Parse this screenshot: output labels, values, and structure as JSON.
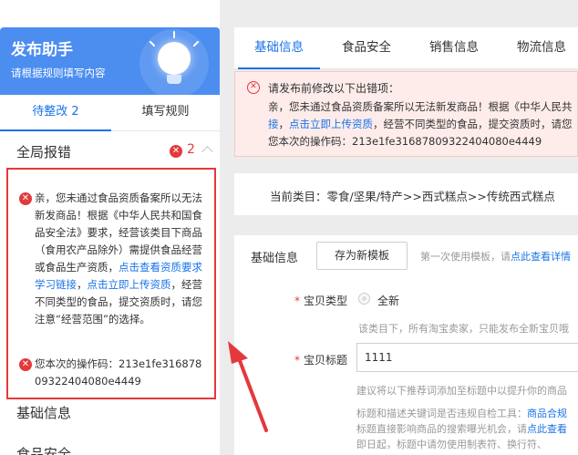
{
  "helper": {
    "title": "发布助手",
    "subtitle": "请根据规则填写内容"
  },
  "left_tabs": {
    "pending": "待整改 2",
    "rules": "填写规则"
  },
  "global_error": {
    "label": "全局报错",
    "count": "2"
  },
  "errors": {
    "e1_a": "亲，您未通过食品资质备案所以无法新发商品！根据《中华人民共和国食品安全法》要求，经营该类目下商品（食用农产品除外）需提供食品经营或食品生产资质，",
    "e1_link1": "点击查看资质要求学习链接",
    "e1_b": "，",
    "e1_link2": "点击立即上传资质",
    "e1_c": "，经营不同类型的食品，提交资质时，请您注意“经营范围”的选择。",
    "e2_label": "您本次的操作码：",
    "e2_code": "213e1fe31687809322404080e4449"
  },
  "left_sections": {
    "basic": "基础信息",
    "food": "食品安全"
  },
  "main_tabs": [
    "基础信息",
    "食品安全",
    "销售信息",
    "物流信息"
  ],
  "alert": {
    "title": "请发布前修改以下出错项：",
    "line1": "亲，您未通过食品资质备案所以无法新发商品！根据《中华人民共",
    "line2_link1": "接",
    "line2_sep": "，",
    "line2_link2": "点击立即上传资质",
    "line2_rest": "，经营不同类型的食品，提交资质时，请您",
    "line3": "您本次的操作码：213e1fe31687809322404080e4449"
  },
  "category": {
    "text": "当前类目：零食/坚果/特产>>西式糕点>>传统西式糕点"
  },
  "form": {
    "section_title": "基础信息",
    "save_template": "存为新模板",
    "template_hint": "第一次使用模板，请",
    "template_link": "点此查看详情",
    "type_label": "宝贝类型",
    "type_value": "全新",
    "type_hint": "该类目下，所有淘宝卖家，只能发布全新宝贝哦",
    "title_label": "宝贝标题",
    "title_value": "1111",
    "title_hint1": "建议将以下推荐词添加至标题中以提升你的商品",
    "title_hint2": "标题和描述关键词是否违规自检工具：",
    "title_hint2_link": "商品合规",
    "title_hint3": "标题直接影响商品的搜索曝光机会，请",
    "title_hint3_link": "点此查看",
    "title_hint4": "即日起，标题中请勿使用制表符、换行符、"
  },
  "colors": {
    "accent": "#1a73e8",
    "error": "#e4393c",
    "header_blue": "#4c8df0"
  }
}
